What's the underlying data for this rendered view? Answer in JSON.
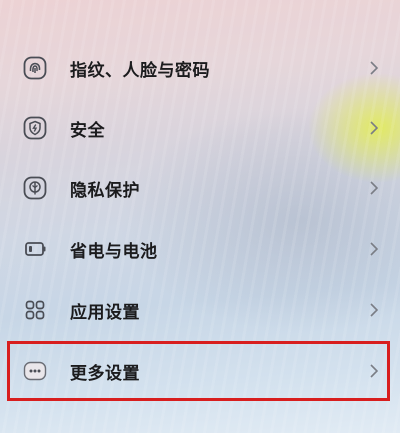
{
  "settings": {
    "items": [
      {
        "label": "指纹、人脸与密码",
        "icon": "fingerprint-icon"
      },
      {
        "label": "安全",
        "icon": "security-shield-icon"
      },
      {
        "label": "隐私保护",
        "icon": "privacy-icon"
      },
      {
        "label": "省电与电池",
        "icon": "battery-icon"
      },
      {
        "label": "应用设置",
        "icon": "apps-grid-icon"
      },
      {
        "label": "更多设置",
        "icon": "more-dots-icon"
      }
    ]
  },
  "colors": {
    "icon_stroke": "#4a4d55",
    "highlight_border": "#d81e1e",
    "text": "#1b1b1d"
  }
}
